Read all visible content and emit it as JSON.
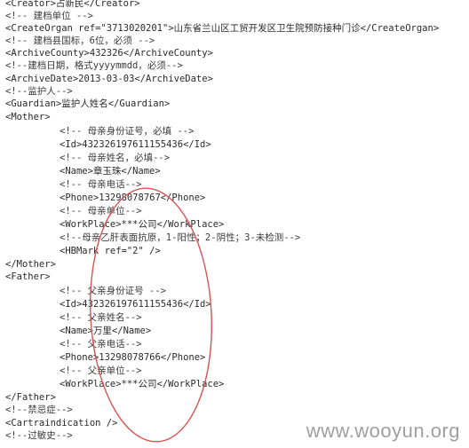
{
  "lines": [
    {
      "text": "<Creator>占新民</Creator>",
      "indent": false,
      "kind": "tag"
    },
    {
      "text": "<!-- 建档单位 -->",
      "indent": false,
      "kind": "cmt"
    },
    {
      "text": "<CreateOrgan ref=\"3713020201\">山东省兰山区工贸开发区卫生院预防接种门诊</CreateOrgan>",
      "indent": false,
      "kind": "tag"
    },
    {
      "text": "<!-- 建档县国标，6位，必须 -->",
      "indent": false,
      "kind": "cmt"
    },
    {
      "text": "<ArchiveCounty>432326</ArchiveCounty>",
      "indent": false,
      "kind": "tag"
    },
    {
      "text": "<!--建档日期，格式yyyymmdd，必须-->",
      "indent": false,
      "kind": "cmt"
    },
    {
      "text": "<ArchiveDate>2013-03-03</ArchiveDate>",
      "indent": false,
      "kind": "tag"
    },
    {
      "text": "<!--监护人-->",
      "indent": false,
      "kind": "cmt"
    },
    {
      "text": "<Guardian>监护人姓名</Guardian>",
      "indent": false,
      "kind": "tag"
    },
    {
      "text": "<Mother>",
      "indent": false,
      "kind": "tag"
    },
    {
      "text": "<!-- 母亲身份证号，必填 -->",
      "indent": true,
      "kind": "cmt"
    },
    {
      "text": "<Id>432326197611155436</Id>",
      "indent": true,
      "kind": "tag"
    },
    {
      "text": "<!-- 母亲姓名，必填-->",
      "indent": true,
      "kind": "cmt"
    },
    {
      "text": "<Name>章玉珠</Name>",
      "indent": true,
      "kind": "tag"
    },
    {
      "text": "<!-- 母亲电话-->",
      "indent": true,
      "kind": "cmt"
    },
    {
      "text": "<Phone>13298078767</Phone>",
      "indent": true,
      "kind": "tag"
    },
    {
      "text": "<!-- 母亲单位-->",
      "indent": true,
      "kind": "cmt"
    },
    {
      "text": "<WorkPlace>***公司</WorkPlace>",
      "indent": true,
      "kind": "tag"
    },
    {
      "text": "<!--母亲乙肝表面抗原，1-阳性；2-阴性；3-未检测-->",
      "indent": true,
      "kind": "cmt"
    },
    {
      "text": "<HBMark ref=\"2\" />",
      "indent": true,
      "kind": "tag"
    },
    {
      "text": "</Mother>",
      "indent": false,
      "kind": "tag"
    },
    {
      "text": "<Father>",
      "indent": false,
      "kind": "tag"
    },
    {
      "text": "<!-- 父亲身份证号 -->",
      "indent": true,
      "kind": "cmt"
    },
    {
      "text": "<Id>432326197611155436</Id>",
      "indent": true,
      "kind": "tag"
    },
    {
      "text": "<!-- 父亲姓名-->",
      "indent": true,
      "kind": "cmt"
    },
    {
      "text": "<Name>万里</Name>",
      "indent": true,
      "kind": "tag"
    },
    {
      "text": "<!-- 父亲电话-->",
      "indent": true,
      "kind": "cmt"
    },
    {
      "text": "<Phone>13298078766</Phone>",
      "indent": true,
      "kind": "tag"
    },
    {
      "text": "<!-- 父亲单位-->",
      "indent": true,
      "kind": "cmt"
    },
    {
      "text": "<WorkPlace>***公司</WorkPlace>",
      "indent": true,
      "kind": "tag"
    },
    {
      "text": "</Father>",
      "indent": false,
      "kind": "tag"
    },
    {
      "text": "<!--禁忌症-->",
      "indent": false,
      "kind": "cmt"
    },
    {
      "text": "<Cartraindication />",
      "indent": false,
      "kind": "tag"
    },
    {
      "text": "<!--过敏史-->",
      "indent": false,
      "kind": "cmt"
    }
  ],
  "watermark": "www.wooyun.org",
  "annotation": {
    "shape": "ellipse",
    "color": "#d9534f"
  }
}
